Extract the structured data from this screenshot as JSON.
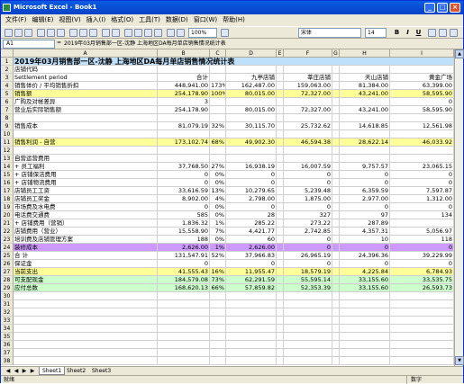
{
  "window": {
    "title": "Microsoft Excel - Book1",
    "min": "_",
    "max": "□",
    "close": "×"
  },
  "menu": [
    "文件(F)",
    "编辑(E)",
    "视图(V)",
    "插入(I)",
    "格式(O)",
    "工具(T)",
    "数据(D)",
    "窗口(W)",
    "帮助(H)"
  ],
  "toolbar": {
    "zoom": "100%",
    "font_name": "宋体",
    "font_size": "14",
    "bold": "B",
    "italic": "I",
    "underline": "U"
  },
  "formula": {
    "namebox": "A1",
    "fx": "=",
    "content": "2019年03月销售部一区-沈静  上海地区DA每月单店销售情况统计表"
  },
  "columns": [
    "A",
    "B",
    "C",
    "D",
    "E",
    "F",
    "G",
    "H",
    "I"
  ],
  "rows": [
    {
      "n": "1",
      "a": "2019年03月销售部一区-沈静  上海地区DA每月单店销售情况统计表",
      "b": "",
      "c": "",
      "d": "",
      "e": "",
      "f": "",
      "g": "",
      "h": "",
      "i": "",
      "bg": "#bfe0fb",
      "title": true
    },
    {
      "n": "2",
      "a": "店铺代码",
      "b": "",
      "c": "",
      "d": "",
      "e": "",
      "f": "",
      "g": "",
      "h": "",
      "i": "",
      "bg": ""
    },
    {
      "n": "3",
      "a": "Settlement period",
      "b": "合计",
      "c": "",
      "d": "九亭店铺",
      "e": "",
      "f": "莘庄店铺",
      "g": "",
      "h": "天山店铺",
      "i": "黄金广场",
      "bg": ""
    },
    {
      "n": "4",
      "a": "销售体价 / 平均销售折扣",
      "b": "448,941.00",
      "c": "173%",
      "d": "162,487.00",
      "e": "",
      "f": "159,063.00",
      "g": "",
      "h": "81,384.00",
      "i": "63,399.00",
      "bg": ""
    },
    {
      "n": "5",
      "a": "销售额",
      "b": "254,178.90",
      "c": "100%",
      "d": "80,015.00",
      "e": "",
      "f": "72,327.00",
      "g": "",
      "h": "43,241.00",
      "i": "58,595.90",
      "bg": "#ffff99"
    },
    {
      "n": "6",
      "a": "广购及对帐差异",
      "b": "3",
      "c": "",
      "d": "",
      "e": "",
      "f": "",
      "g": "",
      "h": "",
      "i": "0",
      "bg": ""
    },
    {
      "n": "7",
      "a": "营业后实际销售额",
      "b": "254,178.90",
      "c": "",
      "d": "80,015.00",
      "e": "",
      "f": "72,327.00",
      "g": "",
      "h": "43,241.00",
      "i": "58,595.90",
      "bg": ""
    },
    {
      "n": "8",
      "a": "",
      "b": "",
      "c": "",
      "d": "",
      "e": "",
      "f": "",
      "g": "",
      "h": "",
      "i": "",
      "bg": ""
    },
    {
      "n": "9",
      "a": "销售成本",
      "b": "81,079.19",
      "c": "32%",
      "d": "30,115.70",
      "e": "",
      "f": "25,732.62",
      "g": "",
      "h": "14,618.85",
      "i": "12,561.98",
      "bg": ""
    },
    {
      "n": "10",
      "a": "",
      "b": "",
      "c": "",
      "d": "",
      "e": "",
      "f": "",
      "g": "",
      "h": "",
      "i": "",
      "bg": ""
    },
    {
      "n": "11",
      "a": "销售利润 - 自营",
      "b": "173,102.74",
      "c": "68%",
      "d": "49,902.30",
      "e": "",
      "f": "46,594.38",
      "g": "",
      "h": "28,622.14",
      "i": "46,033.92",
      "bg": "#ffff99"
    },
    {
      "n": "12",
      "a": "",
      "b": "",
      "c": "",
      "d": "",
      "e": "",
      "f": "",
      "g": "",
      "h": "",
      "i": "",
      "bg": ""
    },
    {
      "n": "13",
      "a": "自营运营费用",
      "b": "",
      "c": "",
      "d": "",
      "e": "",
      "f": "",
      "g": "",
      "h": "",
      "i": "",
      "bg": ""
    },
    {
      "n": "14",
      "a": "    +        员工福利",
      "b": "37,768.50",
      "c": "27%",
      "d": "16,938.19",
      "e": "",
      "f": "16,007.59",
      "g": "",
      "h": "9,757.57",
      "i": "23,065.15",
      "bg": ""
    },
    {
      "n": "15",
      "a": "    +        店铺保洁费用",
      "b": "0",
      "c": "0%",
      "d": "0",
      "e": "",
      "f": "0",
      "g": "",
      "h": "0",
      "i": "0",
      "bg": ""
    },
    {
      "n": "16",
      "a": "    +        店铺物流费用",
      "b": "0",
      "c": "0%",
      "d": "0",
      "e": "",
      "f": "0",
      "g": "",
      "h": "0",
      "i": "0",
      "bg": ""
    },
    {
      "n": "17",
      "a": "             店铺员工工资",
      "b": "33,616.59",
      "c": "13%",
      "d": "10,279.65",
      "e": "",
      "f": "5,239.48",
      "g": "",
      "h": "6,359.59",
      "i": "7,597.87",
      "bg": ""
    },
    {
      "n": "18",
      "a": "             店铺员工奖金",
      "b": "8,902.00",
      "c": "4%",
      "d": "2,798.00",
      "e": "",
      "f": "1,875.00",
      "g": "",
      "h": "2,977.00",
      "i": "1,312.00",
      "bg": ""
    },
    {
      "n": "19",
      "a": "             市场费及水电费",
      "b": "0",
      "c": "0%",
      "d": "0",
      "e": "",
      "f": "0",
      "g": "",
      "h": "0",
      "i": "0",
      "bg": ""
    },
    {
      "n": "20",
      "a": "             电话费交通费",
      "b": "585",
      "c": "0%",
      "d": "28",
      "e": "",
      "f": "327",
      "g": "",
      "h": "97",
      "i": "134",
      "bg": ""
    },
    {
      "n": "21",
      "a": "    +        店铺费用（营销）",
      "b": "1,836.32",
      "c": "1%",
      "d": "285.22",
      "e": "",
      "f": "273.22",
      "g": "",
      "h": "287.89",
      "i": "",
      "bg": ""
    },
    {
      "n": "22",
      "a": "             店铺费用（营业）",
      "b": "15,558.90",
      "c": "7%",
      "d": "4,421.77",
      "e": "",
      "f": "2,742.85",
      "g": "",
      "h": "4,357.31",
      "i": "5,056.97",
      "bg": ""
    },
    {
      "n": "23",
      "a": "             培训费及店铺管理方案",
      "b": "188",
      "c": "0%",
      "d": "60",
      "e": "",
      "f": "0",
      "g": "",
      "h": "10",
      "i": "118",
      "bg": ""
    },
    {
      "n": "24",
      "a": "             装修成本",
      "b": "2,626.00",
      "c": "1%",
      "d": "2,626.00",
      "e": "",
      "f": "0",
      "g": "",
      "h": "0",
      "i": "0",
      "bg": "#cc99ff"
    },
    {
      "n": "25",
      "a": "合 计",
      "b": "131,547.91",
      "c": "52%",
      "d": "37,966.83",
      "e": "",
      "f": "26,965.19",
      "g": "",
      "h": "24,396.36",
      "i": "39,229.99",
      "bg": ""
    },
    {
      "n": "26",
      "a": "保证金",
      "b": "0",
      "c": "",
      "d": "0",
      "e": "",
      "f": "0",
      "g": "",
      "h": "0",
      "i": "0",
      "bg": ""
    },
    {
      "n": "27",
      "a": "当前支出",
      "b": "41,555.43",
      "c": "16%",
      "d": "11,955.47",
      "e": "",
      "f": "18,579.19",
      "g": "",
      "h": "4,225.84",
      "i": "6,784.93",
      "bg": "#ffff99"
    },
    {
      "n": "28",
      "a": "可支配现金",
      "b": "184,579.08",
      "c": "73%",
      "d": "62,291.59",
      "e": "",
      "f": "55,595.14",
      "g": "",
      "h": "33,155.60",
      "i": "33,535.75",
      "bg": "#ccffcc"
    },
    {
      "n": "29",
      "a": "应付总数",
      "b": "168,620.13",
      "c": "66%",
      "d": "57,859.82",
      "e": "",
      "f": "52,353.39",
      "g": "",
      "h": "33,155.60",
      "i": "26,593.73",
      "bg": "#ccffcc"
    },
    {
      "n": "30",
      "a": "",
      "b": "",
      "c": "",
      "d": "",
      "e": "",
      "f": "",
      "g": "",
      "h": "",
      "i": "",
      "bg": ""
    },
    {
      "n": "31",
      "a": "",
      "b": "",
      "c": "",
      "d": "",
      "e": "",
      "f": "",
      "g": "",
      "h": "",
      "i": "",
      "bg": ""
    },
    {
      "n": "32",
      "a": "",
      "b": "",
      "c": "",
      "d": "",
      "e": "",
      "f": "",
      "g": "",
      "h": "",
      "i": "",
      "bg": ""
    },
    {
      "n": "33",
      "a": "",
      "b": "",
      "c": "",
      "d": "",
      "e": "",
      "f": "",
      "g": "",
      "h": "",
      "i": "",
      "bg": ""
    },
    {
      "n": "34",
      "a": "",
      "b": "",
      "c": "",
      "d": "",
      "e": "",
      "f": "",
      "g": "",
      "h": "",
      "i": "",
      "bg": ""
    },
    {
      "n": "35",
      "a": "",
      "b": "",
      "c": "",
      "d": "",
      "e": "",
      "f": "",
      "g": "",
      "h": "",
      "i": "",
      "bg": ""
    },
    {
      "n": "36",
      "a": "",
      "b": "",
      "c": "",
      "d": "",
      "e": "",
      "f": "",
      "g": "",
      "h": "",
      "i": "",
      "bg": ""
    },
    {
      "n": "37",
      "a": "",
      "b": "",
      "c": "",
      "d": "",
      "e": "",
      "f": "",
      "g": "",
      "h": "",
      "i": "",
      "bg": ""
    },
    {
      "n": "38",
      "a": "",
      "b": "",
      "c": "",
      "d": "",
      "e": "",
      "f": "",
      "g": "",
      "h": "",
      "i": "",
      "bg": ""
    }
  ],
  "sheets": [
    "Sheet1",
    "Sheet2",
    "Sheet3"
  ],
  "status": {
    "left": "就绪",
    "right": "数字"
  }
}
